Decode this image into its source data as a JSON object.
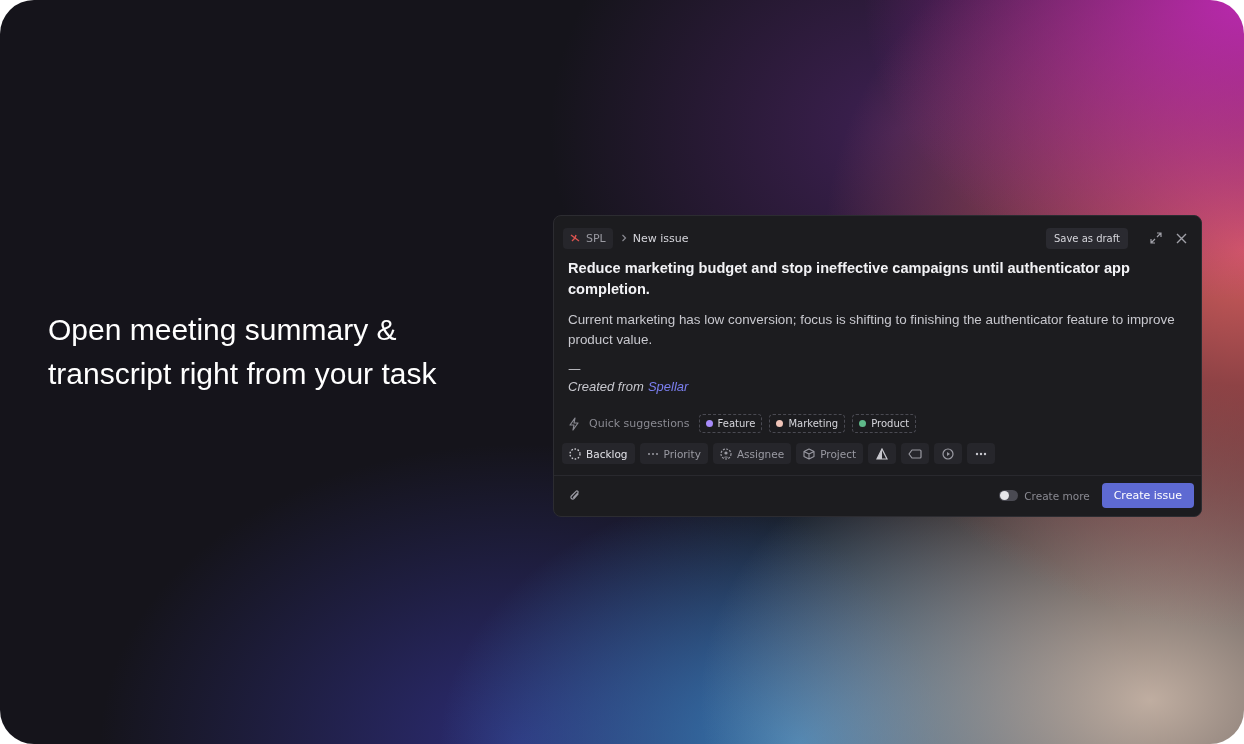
{
  "headline": "Open meeting summary & transcript right from your task",
  "dialog": {
    "team": "SPL",
    "breadcrumb": "New issue",
    "save_button": "Save as draft",
    "title": "Reduce marketing budget and stop ineffective campaigns until authenticator app completion.",
    "description": "Current marketing has low conversion; focus is shifting to finishing the authenticator feature to improve product value.",
    "separator": "—",
    "created_prefix": "Created from",
    "created_link": "Spellar",
    "suggestions_label": "Quick suggestions",
    "suggestions": [
      {
        "label": "Feature",
        "color": "#a78bfa"
      },
      {
        "label": "Marketing",
        "color": "#f0c4b8"
      },
      {
        "label": "Product",
        "color": "#5fb98a"
      }
    ],
    "properties": [
      {
        "kind": "status",
        "label": "Backlog"
      },
      {
        "kind": "priority",
        "label": "Priority"
      },
      {
        "kind": "assignee",
        "label": "Assignee"
      },
      {
        "kind": "project",
        "label": "Project"
      },
      {
        "kind": "estimate"
      },
      {
        "kind": "label"
      },
      {
        "kind": "cycle"
      },
      {
        "kind": "more"
      }
    ],
    "create_more": {
      "label": "Create more",
      "on": false
    },
    "create_button": "Create issue"
  }
}
